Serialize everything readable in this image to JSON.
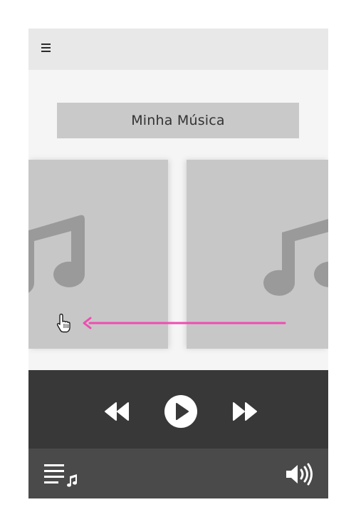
{
  "header": {
    "menu_icon": "hamburger-icon"
  },
  "main": {
    "title": "Minha Música"
  },
  "carousel": {
    "cards": [
      {
        "icon": "music-note-icon"
      },
      {
        "icon": "music-note-icon"
      }
    ],
    "gesture": {
      "direction": "left",
      "icon": "hand-pointer-icon",
      "color": "#ef4db1"
    }
  },
  "player": {
    "controls": [
      "rewind-icon",
      "play-icon",
      "fast-forward-icon"
    ]
  },
  "bottom_bar": {
    "left_icon": "playlist-icon",
    "right_icon": "volume-icon"
  },
  "colors": {
    "top_bar": "#e8e8e8",
    "title_box": "#c9c9c9",
    "card": "#c7c7c7",
    "note": "#9a9a9a",
    "controls_bg": "#383838",
    "bottom_bar_bg": "#4a4a4a",
    "accent": "#ef4db1"
  }
}
